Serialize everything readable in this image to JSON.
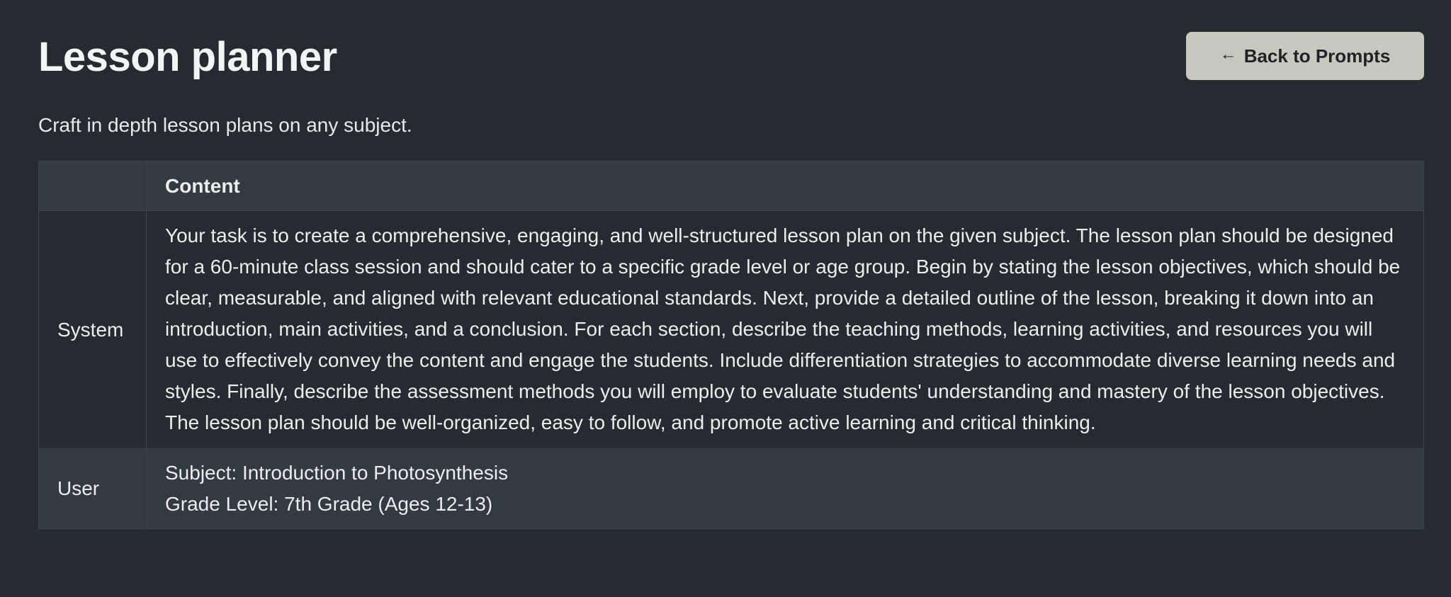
{
  "header": {
    "title": "Lesson planner",
    "back_button_label": "Back to Prompts",
    "back_icon": "arrow-left-icon"
  },
  "subtitle": "Craft in depth lesson plans on any subject.",
  "table": {
    "headers": [
      "",
      "Content"
    ],
    "rows": [
      {
        "role": "System",
        "content": "Your task is to create a comprehensive, engaging, and well-structured lesson plan on the given subject. The lesson plan should be designed for a 60-minute class session and should cater to a specific grade level or age group. Begin by stating the lesson objectives, which should be clear, measurable, and aligned with relevant educational standards. Next, provide a detailed outline of the lesson, breaking it down into an introduction, main activities, and a conclusion. For each section, describe the teaching methods, learning activities, and resources you will use to effectively convey the content and engage the students. Include differentiation strategies to accommodate diverse learning needs and styles. Finally, describe the assessment methods you will employ to evaluate students' understanding and mastery of the lesson objectives. The lesson plan should be well-organized, easy to follow, and promote active learning and critical thinking."
      },
      {
        "role": "User",
        "content_lines": [
          "Subject: Introduction to Photosynthesis",
          "Grade Level: 7th Grade (Ages 12-13)"
        ]
      }
    ]
  },
  "colors": {
    "background": "#262b31",
    "header_row": "#343a41",
    "button": "#c9c8bf",
    "border": "#3e454d"
  }
}
